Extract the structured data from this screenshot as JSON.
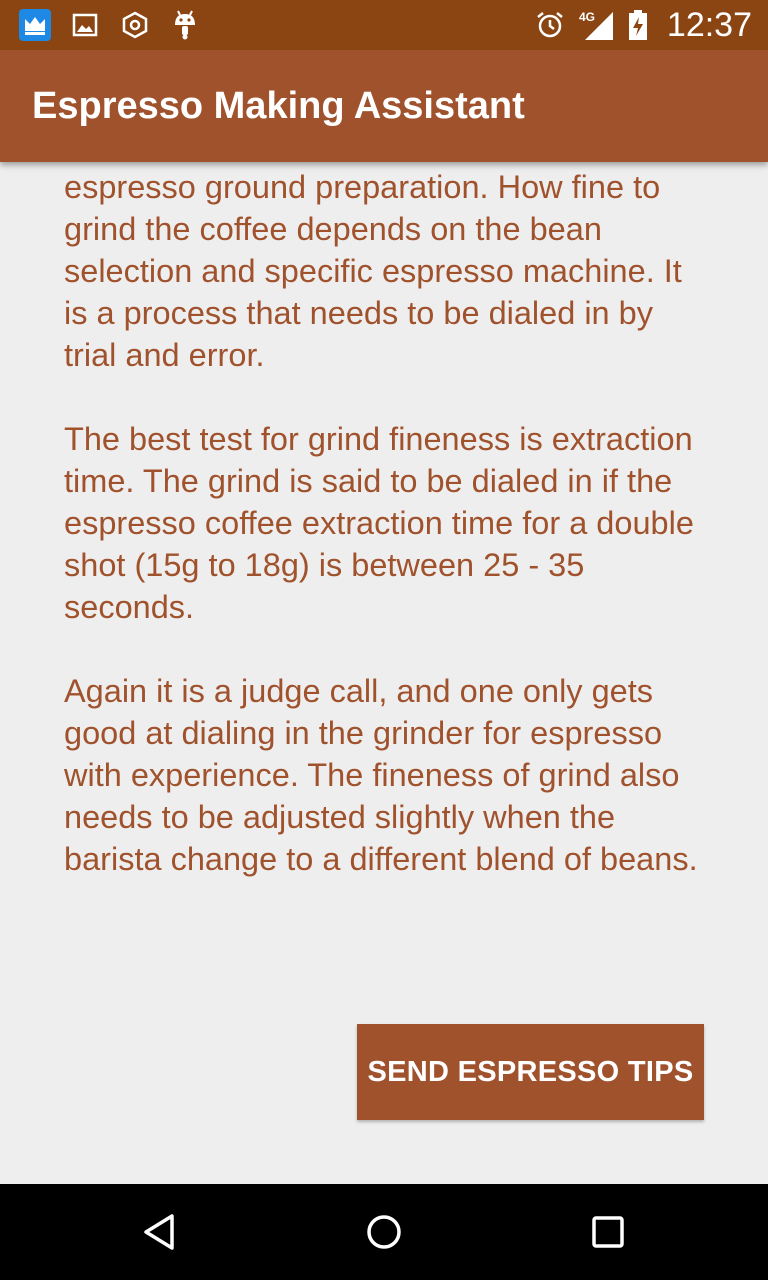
{
  "status_bar": {
    "time": "12:37",
    "network": "4G",
    "icons": [
      "crown-icon",
      "image-icon",
      "hexagon-icon",
      "android-icon",
      "alarm-icon",
      "signal-icon",
      "battery-charging-icon"
    ]
  },
  "app_bar": {
    "title": "Espresso Making Assistant"
  },
  "content": {
    "paragraphs": [
      "espresso ground preparation. How fine to grind the coffee depends on the bean selection and specific espresso machine. It is a process that needs to be dialed in by trial and error.",
      "The best test for grind fineness is extraction time. The grind is said to be dialed in if the espresso coffee extraction time for a double shot (15g to 18g) is between 25 - 35 seconds.",
      "Again it is a judge call, and one only gets good at dialing in the grinder for espresso with experience. The fineness of grind also needs to be adjusted slightly when the barista change to a different blend of beans."
    ],
    "send_button_label": "SEND ESPRESSO TIPS"
  },
  "nav_bar": {
    "buttons": [
      "back-icon",
      "home-icon",
      "recents-icon"
    ]
  },
  "colors": {
    "status_bar": "#8b4513",
    "app_bar": "#a0522d",
    "text": "#a0522d",
    "background": "#eeeeee"
  }
}
